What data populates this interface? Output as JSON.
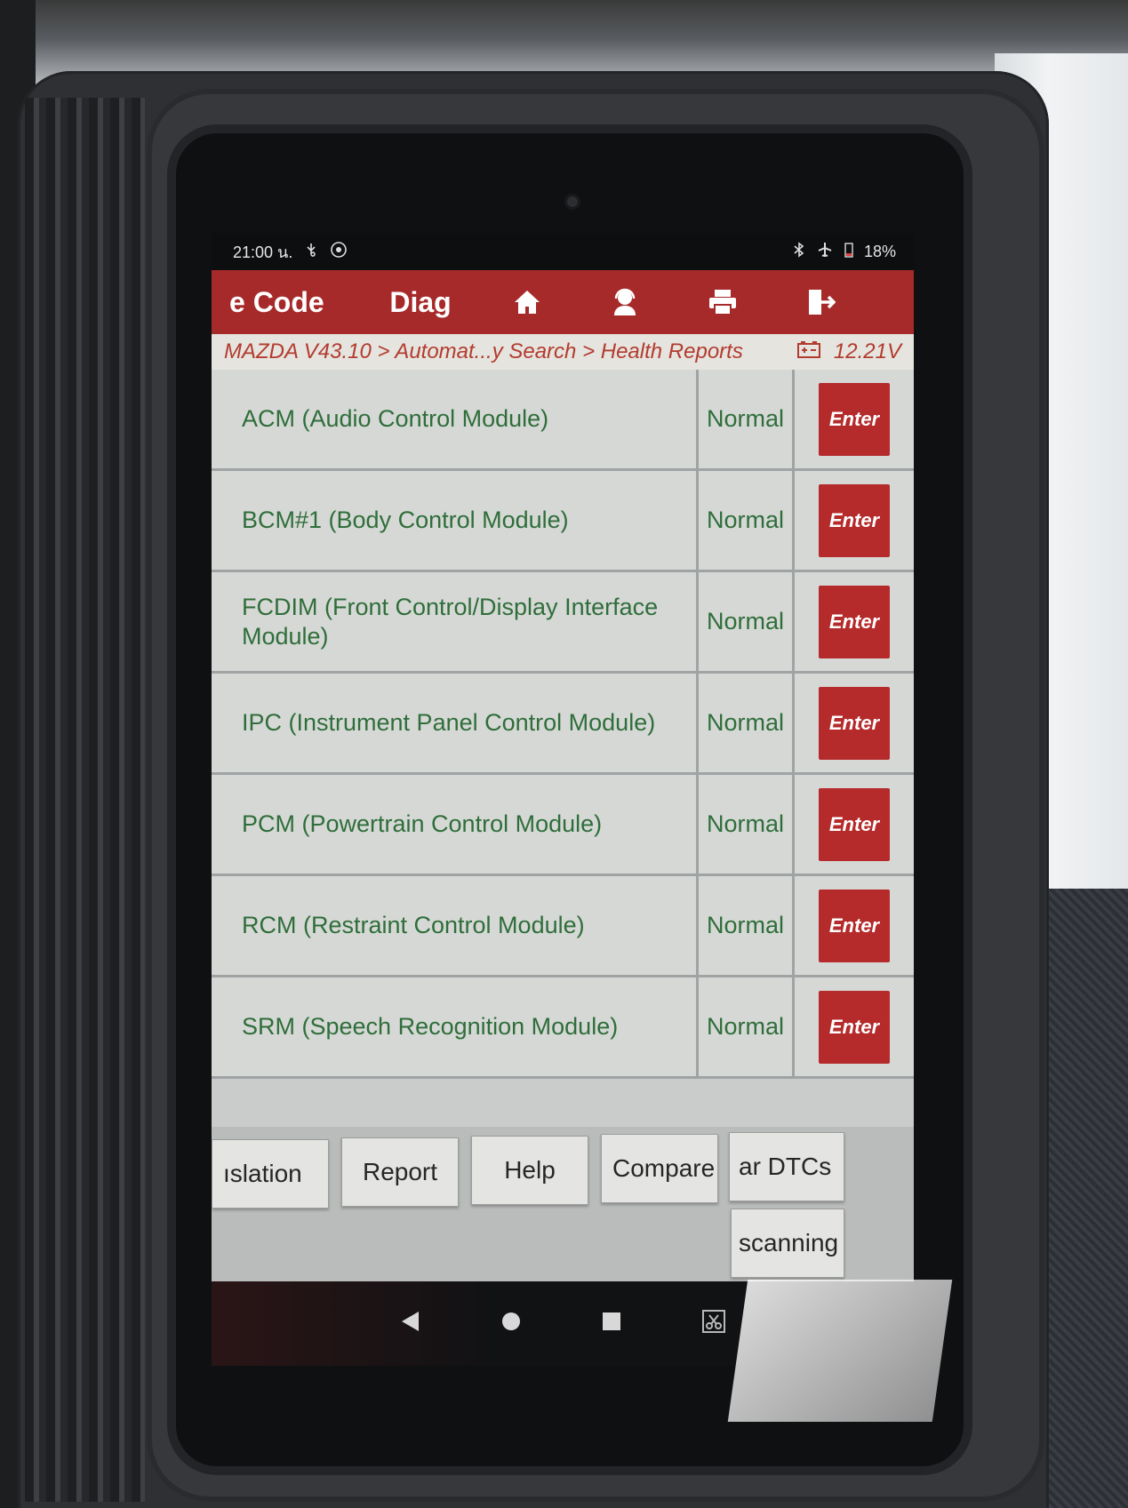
{
  "statusbar": {
    "time": "21:00 น.",
    "battery": "18%"
  },
  "topbar": {
    "tab_code": "e Code",
    "tab_diag": "Diag",
    "icons": [
      "home-icon",
      "support-agent-icon",
      "printer-icon",
      "exit-icon"
    ]
  },
  "breadcrumb": {
    "path": "MAZDA V43.10 > Automat...y Search > Health Reports",
    "voltage": "12.21V"
  },
  "modules": [
    {
      "name": "ACM (Audio Control Module)",
      "status": "Normal",
      "action": "Enter"
    },
    {
      "name": "BCM#1 (Body Control Module)",
      "status": "Normal",
      "action": "Enter"
    },
    {
      "name": "FCDIM (Front Control/Display Interface Module)",
      "status": "Normal",
      "action": "Enter"
    },
    {
      "name": "IPC (Instrument Panel Control Module)",
      "status": "Normal",
      "action": "Enter"
    },
    {
      "name": "PCM (Powertrain Control Module)",
      "status": "Normal",
      "action": "Enter"
    },
    {
      "name": "RCM (Restraint Control Module)",
      "status": "Normal",
      "action": "Enter"
    },
    {
      "name": "SRM (Speech Recognition Module)",
      "status": "Normal",
      "action": "Enter"
    }
  ],
  "bottom_buttons": {
    "translation": "ıslation",
    "report": "Report",
    "help": "Help",
    "compare": "Compare",
    "clear_dtcs": "ar DTCs",
    "scanning": "scanning"
  },
  "colors": {
    "accent_red": "#a72a2a",
    "status_green": "#2f6e3a",
    "breadcrumb_red": "#b33b2e"
  }
}
